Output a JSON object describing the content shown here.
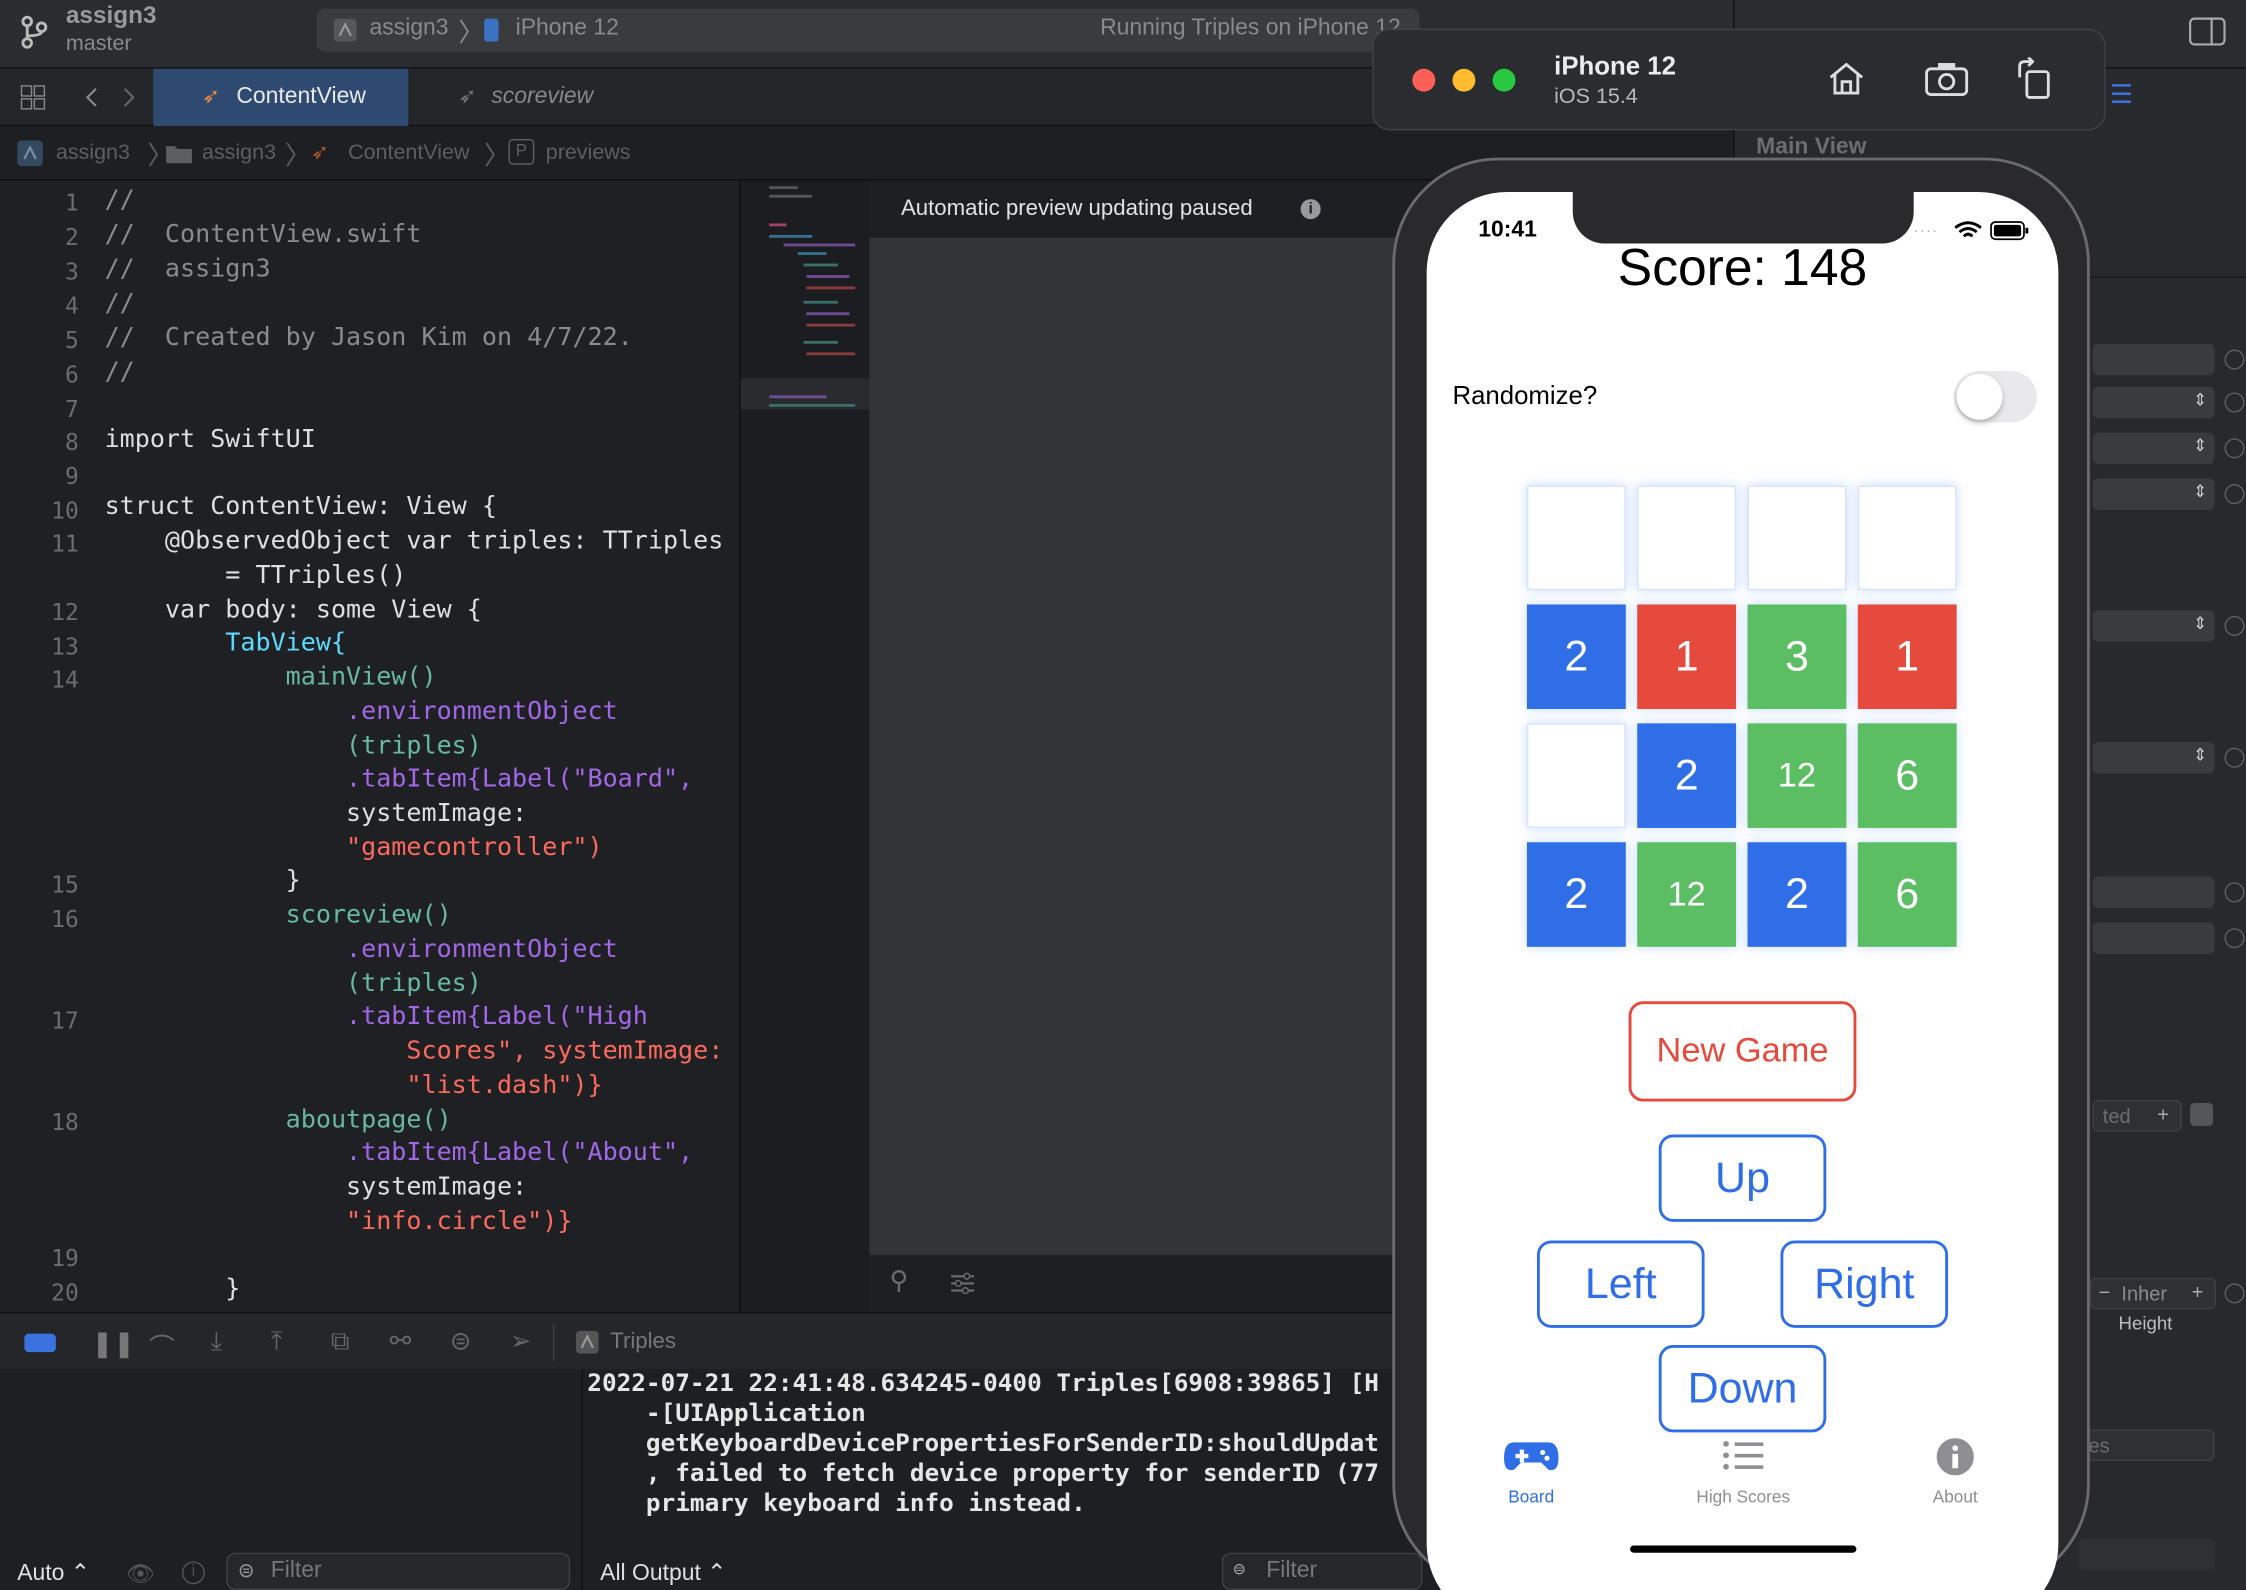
{
  "toolbar": {
    "project_name": "assign3",
    "branch": "master",
    "scheme_target": "assign3",
    "scheme_device": "iPhone 12",
    "status": "Running Triples on iPhone 12"
  },
  "tabs": [
    {
      "label": "ContentView",
      "active": true
    },
    {
      "label": "scoreview",
      "active": false
    }
  ],
  "breadcrumb": [
    "assign3",
    "assign3",
    "ContentView",
    "previews"
  ],
  "inspector": {
    "title": "Main View",
    "ted_label": "ted",
    "inherit_label": "Inher",
    "height_label": "Height",
    "es_label": "es"
  },
  "editor": {
    "line_numbers": [
      "1",
      "2",
      "3",
      "4",
      "5",
      "6",
      "7",
      "8",
      "9",
      "10",
      "11",
      "12",
      "13",
      "14",
      "15",
      "16",
      "17",
      "18",
      "19",
      "20"
    ],
    "lines": [
      "//",
      "//  ContentView.swift",
      "//  assign3",
      "//",
      "//  Created by Jason Kim on 4/7/22.",
      "//",
      "",
      "import SwiftUI",
      "",
      "struct ContentView: View {",
      "    @ObservedObject var triples: TTriples",
      "        = TTriples()",
      "    var body: some View {",
      "        TabView{",
      "            mainView()",
      "                .environmentObject",
      "                (triples)",
      "                .tabItem{Label(\"Board\",",
      "                systemImage:",
      "                \"gamecontroller\")",
      "            }",
      "            scoreview()",
      "                .environmentObject",
      "                (triples)",
      "                .tabItem{Label(\"High",
      "                    Scores\", systemImage:",
      "                    \"list.dash\")}",
      "            aboutpage()",
      "                .tabItem{Label(\"About\",",
      "                systemImage:",
      "                \"info.circle\")}",
      "",
      "        }"
    ]
  },
  "canvas": {
    "status": "Automatic preview updating paused"
  },
  "debug": {
    "process": "Triples",
    "console_lines": [
      "2022-07-21 22:41:48.634245-0400 Triples[6908:39865] [H",
      "    -[UIApplication",
      "    getKeyboardDevicePropertiesForSenderID:shouldUpdat",
      "    , failed to fetch device property for senderID (77",
      "    primary keyboard info instead."
    ],
    "auto_label": "Auto ⌃",
    "output_label": "All Output ⌃",
    "filter_placeholder": "Filter"
  },
  "simulator": {
    "device": "iPhone 12",
    "os": "iOS 15.4"
  },
  "app": {
    "time": "10:41",
    "score_text": "Score: 148",
    "randomize_label": "Randomize?",
    "randomize_on": false,
    "board": [
      [
        "",
        "",
        "",
        ""
      ],
      [
        "2",
        "1",
        "3",
        "1"
      ],
      [
        "",
        "2",
        "12",
        "6"
      ],
      [
        "2",
        "12",
        "2",
        "6"
      ]
    ],
    "new_game_label": "New Game",
    "up_label": "Up",
    "left_label": "Left",
    "right_label": "Right",
    "down_label": "Down",
    "tab_items": [
      {
        "label": "Board",
        "icon": "gamecontroller-icon",
        "active": true
      },
      {
        "label": "High Scores",
        "icon": "list-icon",
        "active": false
      },
      {
        "label": "About",
        "icon": "info-circle-icon",
        "active": false
      }
    ]
  },
  "colors": {
    "tile_blue": "#2f6ee6",
    "tile_red": "#e64a3c",
    "tile_green": "#5cbe62",
    "accent": "#2f6ee6"
  }
}
